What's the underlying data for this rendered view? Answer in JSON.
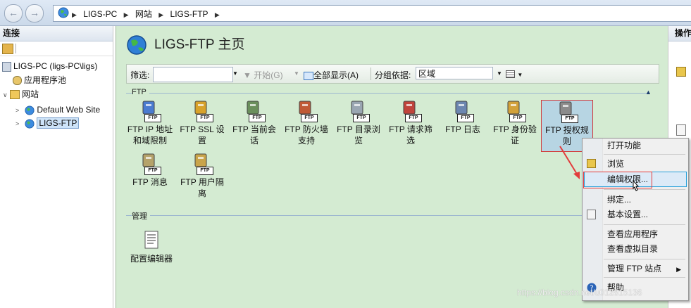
{
  "address": {
    "crumbs": [
      "LIGS-PC",
      "网站",
      "LIGS-FTP"
    ],
    "back_icon": "back-arrow",
    "forward_icon": "forward-arrow"
  },
  "connections": {
    "title": "连接",
    "tree": {
      "server": "LIGS-PC (ligs-PC\\ligs)",
      "app_pools": "应用程序池",
      "sites": "网站",
      "site_default": "Default Web Site",
      "site_ftp": "LIGS-FTP"
    }
  },
  "actions": {
    "title": "操作"
  },
  "main": {
    "title": "LIGS-FTP 主页",
    "filter": {
      "label": "筛选:",
      "value": "",
      "start": "开始(G)",
      "show_all": "全部显示(A)",
      "group_label": "分组依据:",
      "group_value": "区域"
    },
    "groups": {
      "ftp": "FTP",
      "manage": "管理"
    },
    "features": [
      {
        "l1": "FTP IP 地址",
        "l2": "和域限制"
      },
      {
        "l1": "FTP SSL 设",
        "l2": "置"
      },
      {
        "l1": "FTP 当前会",
        "l2": "话"
      },
      {
        "l1": "FTP 防火墙",
        "l2": "支持"
      },
      {
        "l1": "FTP 目录浏",
        "l2": "览"
      },
      {
        "l1": "FTP 请求筛",
        "l2": "选"
      },
      {
        "l1": "FTP 日志",
        "l2": ""
      },
      {
        "l1": "FTP 身份验",
        "l2": "证"
      },
      {
        "l1": "FTP 授权规",
        "l2": "则"
      },
      {
        "l1": "FTP 消息",
        "l2": ""
      },
      {
        "l1": "FTP 用户隔",
        "l2": "离"
      }
    ],
    "manage_features": [
      {
        "l1": "配置编辑器"
      }
    ],
    "ftp_tag": "FTP"
  },
  "context_menu": {
    "items": [
      "打开功能",
      "浏览",
      "编辑权限...",
      "绑定...",
      "基本设置...",
      "查看应用程序",
      "查看虚拟目录",
      "管理 FTP 站点",
      "帮助"
    ]
  },
  "watermark": "https://blog.csdn.net/u012815136",
  "colors": {
    "content_bg": "#d4ebd2",
    "highlight": "#26a0da",
    "annotation": "#e23c3c"
  }
}
